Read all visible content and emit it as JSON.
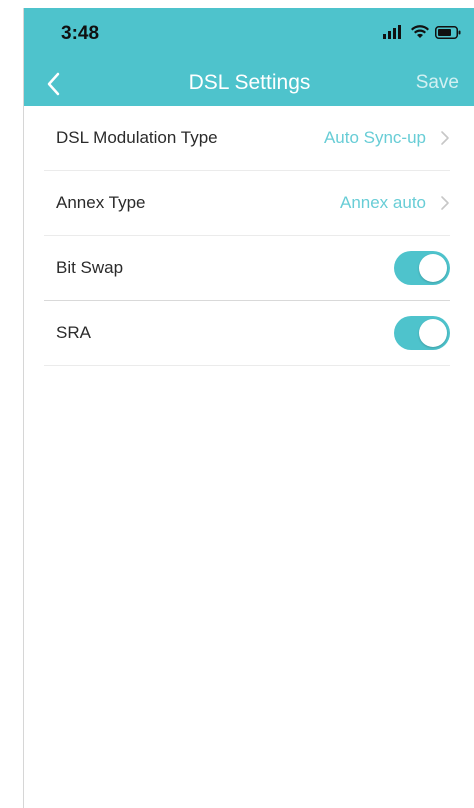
{
  "status_bar": {
    "time": "3:48"
  },
  "nav": {
    "title": "DSL Settings",
    "save_label": "Save"
  },
  "settings": [
    {
      "label": "DSL Modulation Type",
      "value": "Auto Sync-up"
    },
    {
      "label": "Annex Type",
      "value": "Annex auto"
    },
    {
      "label": "Bit Swap",
      "enabled": true
    },
    {
      "label": "SRA",
      "enabled": true
    }
  ],
  "colors": {
    "accent": "#4ec3cc",
    "value_text": "#68cdd6"
  }
}
